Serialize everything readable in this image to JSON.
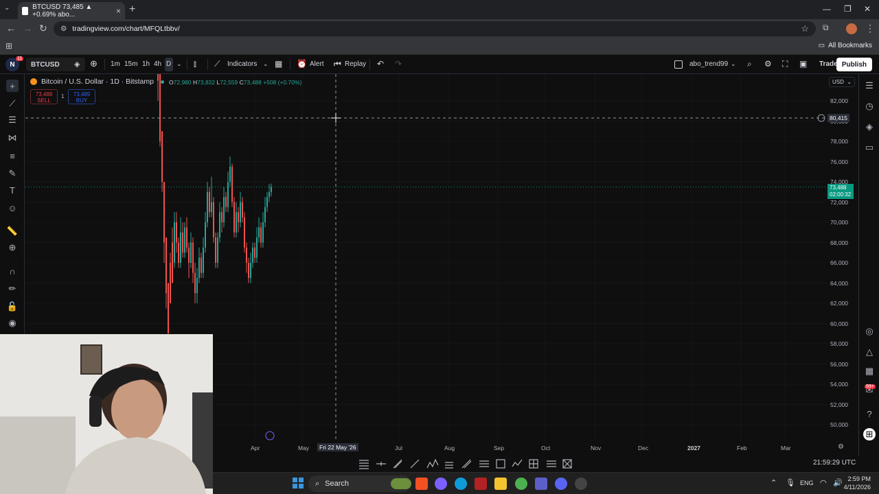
{
  "browser": {
    "tab_title": "BTCUSD 73,485 ▲ +0.69% abo...",
    "url": "tradingview.com/chart/MFQLtbbv/",
    "all_bookmarks": "All Bookmarks"
  },
  "toolbar": {
    "avatar_letter": "N",
    "avatar_badge": "11",
    "symbol": "BTCUSD",
    "intervals": [
      "1m",
      "15m",
      "1h",
      "4h",
      "D"
    ],
    "indicators_label": "Indicators",
    "alert_label": "Alert",
    "replay_label": "Replay",
    "layout_name": "abo_trend99",
    "trade_label": "Trade",
    "publish_label": "Publish"
  },
  "legend": {
    "title": "Bitcoin / U.S. Dollar · 1D · Bitstamp",
    "open_label": "O",
    "open": "72,980",
    "high_label": "H",
    "high": "73,832",
    "low_label": "L",
    "low": "72,559",
    "close_label": "C",
    "close": "73,488",
    "change": "+508 (+0.70%)",
    "sell_price": "73,488",
    "sell_label": "SELL",
    "spread": "1",
    "buy_price": "73,489",
    "buy_label": "BUY"
  },
  "price_scale": {
    "currency": "USD",
    "labels": [
      "82,000",
      "80,000",
      "78,000",
      "76,000",
      "74,000",
      "72,000",
      "70,000",
      "68,000",
      "66,000",
      "64,000",
      "62,000",
      "60,000",
      "58,000",
      "56,000",
      "54,000",
      "52,000",
      "50,000"
    ],
    "crosshair_price": "80,415",
    "last_price": "73,488",
    "countdown": "02:00:32"
  },
  "time_scale": {
    "labels": [
      "Apr",
      "May",
      "Jul",
      "Aug",
      "Sep",
      "Oct",
      "Nov",
      "Dec",
      "2027",
      "Feb",
      "Mar"
    ],
    "crosshair_date": "Fri 22 May '26",
    "clock": "21:59:29 UTC"
  },
  "colors": {
    "up": "#26a69a",
    "down": "#ef5350",
    "bg": "#0f0f0f",
    "last_price": "#089981"
  },
  "taskbar": {
    "search_label": "Search",
    "lang": "ENG",
    "time": "2:59 PM",
    "date": "4/11/2026",
    "chat_badge": "99+"
  }
}
